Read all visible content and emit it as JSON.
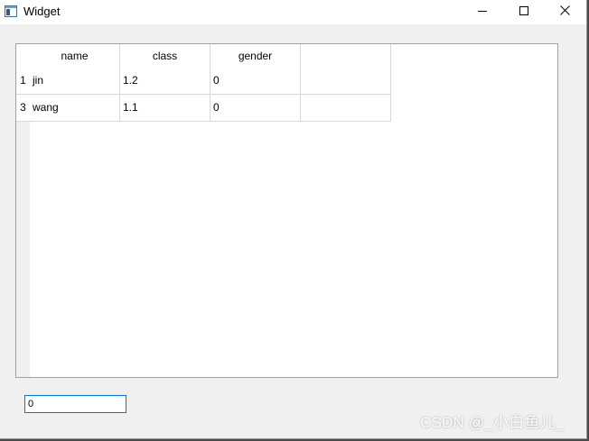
{
  "window": {
    "title": "Widget",
    "app_icon": "window-app-icon",
    "controls": {
      "minimize_icon": "minimize-icon",
      "maximize_icon": "maximize-icon",
      "close_icon": "close-icon"
    }
  },
  "table": {
    "columns": [
      "name",
      "class",
      "gender",
      ""
    ],
    "rows": [
      {
        "header": "1",
        "cells": [
          "jin",
          "1.2",
          "0",
          ""
        ]
      },
      {
        "header": "3",
        "cells": [
          "wang",
          "1.1",
          "0",
          ""
        ]
      }
    ]
  },
  "input": {
    "value": "0"
  },
  "watermark": {
    "text": "CSDN @_小白鱼儿_"
  },
  "colors": {
    "window_bg": "#f0f0f0",
    "titlebar_bg": "#ffffff",
    "grid_line": "#d8d8d8",
    "input_focus_border": "#0078d7"
  }
}
